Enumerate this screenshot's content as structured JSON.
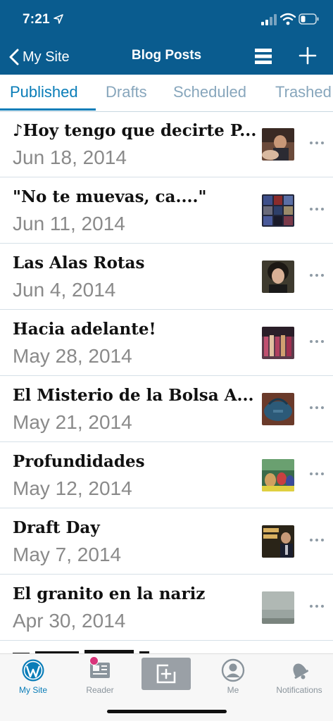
{
  "status_bar": {
    "time": "7:21"
  },
  "nav": {
    "back_label": "My Site",
    "title": "Blog Posts"
  },
  "tabs": [
    {
      "label": "Published",
      "active": true
    },
    {
      "label": "Drafts"
    },
    {
      "label": "Scheduled"
    },
    {
      "label": "Trashed"
    }
  ],
  "posts": [
    {
      "title": "♪Hoy tengo que decirte P...",
      "date": "Jun 18, 2014"
    },
    {
      "title": "\"No te muevas, ca....\"",
      "date": "Jun 11, 2014"
    },
    {
      "title": "Las Alas Rotas",
      "date": "Jun 4, 2014"
    },
    {
      "title": "Hacia adelante!",
      "date": "May 28, 2014"
    },
    {
      "title": "El Misterio de la Bolsa A...",
      "date": "May 21, 2014"
    },
    {
      "title": "Profundidades",
      "date": "May 12, 2014"
    },
    {
      "title": "Draft Day",
      "date": "May 7, 2014"
    },
    {
      "title": "El granito en la nariz",
      "date": "Apr 30, 2014"
    }
  ],
  "tab_bar": {
    "my_site": "My Site",
    "reader": "Reader",
    "me": "Me",
    "notifications": "Notifications"
  },
  "colors": {
    "header": "#0a5c8f",
    "accent": "#0a7db8",
    "inactive_tab": "#87a6bc",
    "badge": "#d8347a"
  }
}
